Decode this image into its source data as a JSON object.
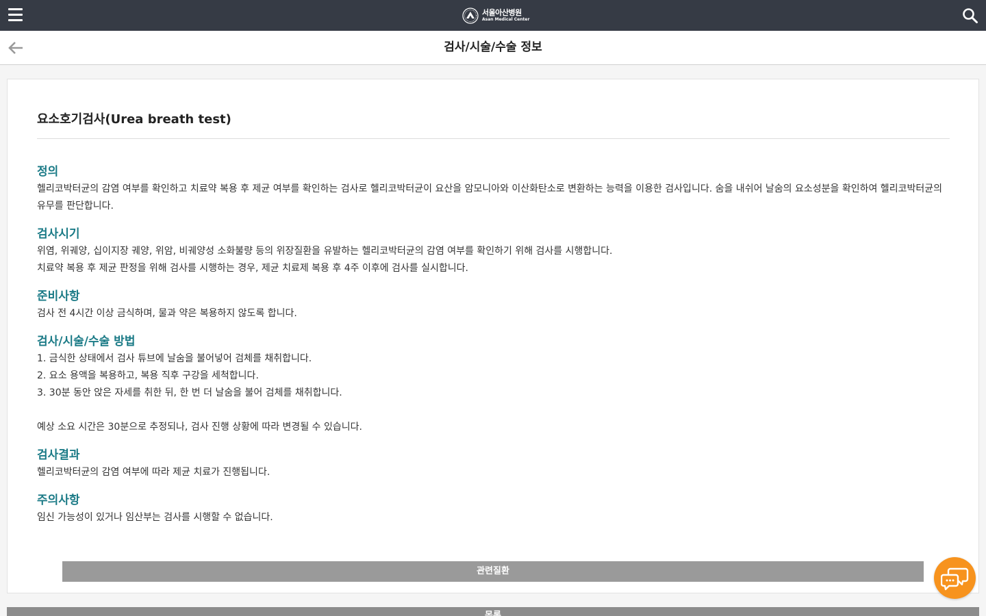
{
  "header": {
    "logo_ko": "서울아산병원",
    "logo_en": "Asan Medical Center",
    "menu_icon": "hamburger-icon",
    "search_icon": "search-icon",
    "bg_color": "#363b45"
  },
  "subheader": {
    "back_icon": "arrow-left-icon",
    "title": "검사/시술/수술 정보"
  },
  "exam": {
    "title": "요소호기검사(Urea breath test)",
    "heading_color": "#1a7a86",
    "sections": [
      {
        "heading": "정의",
        "lines": [
          "헬리코박터균의 감염 여부를 확인하고 치료약 복용 후 제균 여부를 확인하는 검사로 헬리코박터균이 요산을 암모니아와 이산화탄소로 변환하는 능력을 이용한 검사입니다. 숨을 내쉬어 날숨의 요소성분을 확인하여 헬리코박터균의 유무를 판단합니다."
        ]
      },
      {
        "heading": "검사시기",
        "lines": [
          "위염, 위궤양, 십이지장 궤양, 위암, 비궤양성 소화불량 등의 위장질환을 유발하는 헬리코박터균의 감염 여부를 확인하기 위해 검사를 시행합니다.",
          "치료약 복용 후 제균 판정을 위해 검사를 시행하는 경우, 제균 치료제 복용 후 4주 이후에 검사를 실시합니다."
        ]
      },
      {
        "heading": "준비사항",
        "lines": [
          "검사 전 4시간 이상 금식하며, 물과 약은 복용하지 않도록 합니다."
        ]
      },
      {
        "heading": "검사/시술/수술 방법",
        "lines": [
          "1. 금식한 상태에서 검사 튜브에 날숨을 불어넣어 검체를 채취합니다.",
          "2. 요소 용액을 복용하고, 복용 직후 구강을 세척합니다.",
          "3. 30분 동안 앉은 자세를 취한 뒤, 한 번 더 날숨을 불어 검체를 채취합니다.",
          "",
          "예상 소요 시간은 30분으로 추정되나, 검사 진행 상황에 따라 변경될 수 있습니다."
        ]
      },
      {
        "heading": "검사결과",
        "lines": [
          "헬리코박터균의 감염 여부에 따라 제균 치료가 진행됩니다."
        ]
      },
      {
        "heading": "주의사항",
        "lines": [
          "임신 가능성이 있거나 임산부는 검사를 시행할 수 없습니다."
        ]
      }
    ]
  },
  "buttons": {
    "related": "관련질환",
    "list": "목록"
  },
  "chat": {
    "icon": "chat-bubbles-icon",
    "color": "#f7931e"
  }
}
